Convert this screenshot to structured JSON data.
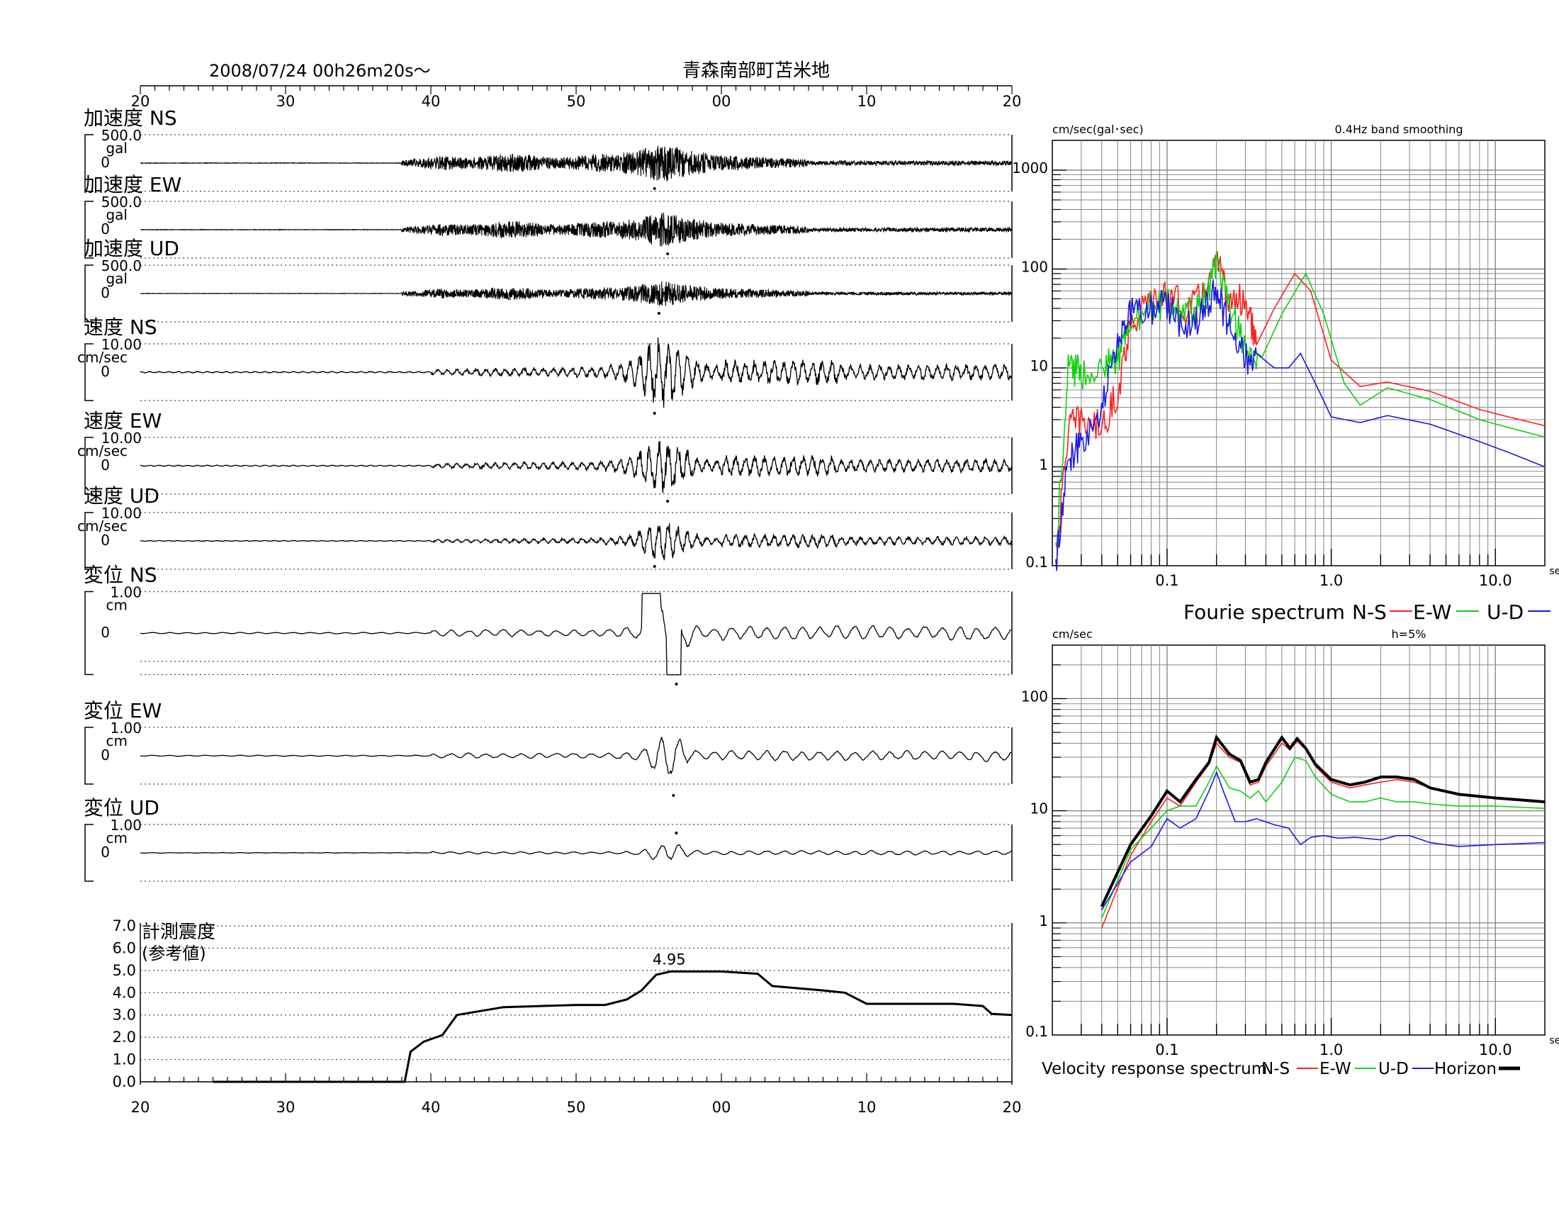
{
  "header": {
    "datetime": "2008/07/24  00h26m20s～",
    "station": "青森南部町苫米地"
  },
  "colors": {
    "ns": "#ff2020",
    "ew": "#10d010",
    "ud": "#1a1ae6",
    "horizon": "#000000",
    "wave": "#000000"
  },
  "time_axis": {
    "ticks": [
      "20",
      "30",
      "40",
      "50",
      "00",
      "10",
      "20"
    ]
  },
  "waveform_panels": [
    {
      "title": "加速度 NS",
      "scale_value": "500.0",
      "unit": "gal",
      "zero": "0"
    },
    {
      "title": "加速度 EW",
      "scale_value": "500.0",
      "unit": "gal",
      "zero": "0"
    },
    {
      "title": "加速度 UD",
      "scale_value": "500.0",
      "unit": "gal",
      "zero": "0"
    },
    {
      "title": "速度 NS",
      "scale_value": "10.00",
      "unit": "cm/sec",
      "zero": "0"
    },
    {
      "title": "速度 EW",
      "scale_value": "10.00",
      "unit": "cm/sec",
      "zero": "0"
    },
    {
      "title": "速度 UD",
      "scale_value": "10.00",
      "unit": "cm/sec",
      "zero": "0"
    },
    {
      "title": "変位 NS",
      "scale_value": "1.00",
      "unit": "cm",
      "zero": "0"
    },
    {
      "title": "変位 EW",
      "scale_value": "1.00",
      "unit": "cm",
      "zero": "0"
    },
    {
      "title": "変位 UD",
      "scale_value": "1.00",
      "unit": "cm",
      "zero": "0"
    }
  ],
  "chart_data": [
    {
      "type": "line",
      "title": "計測震度",
      "subtitle": "(参考値)",
      "ylim": [
        0,
        7
      ],
      "y_ticks": [
        "7.0",
        "6.0",
        "5.0",
        "4.0",
        "3.0",
        "2.0",
        "1.0",
        "0.0"
      ],
      "x_ticks": [
        "20",
        "30",
        "40",
        "50",
        "00",
        "10",
        "20"
      ],
      "peak_label": "4.95",
      "x": [
        25,
        38.2,
        38.6,
        39.5,
        40.8,
        41.8,
        45,
        50,
        52,
        53.5,
        54.5,
        55.5,
        56.5,
        60,
        62.5,
        63.5,
        67,
        68.5,
        70,
        76,
        78,
        78.6,
        80
      ],
      "values": [
        0,
        0,
        1.35,
        1.8,
        2.1,
        3.0,
        3.35,
        3.45,
        3.45,
        3.7,
        4.1,
        4.8,
        4.95,
        4.95,
        4.85,
        4.3,
        4.1,
        4.0,
        3.5,
        3.5,
        3.4,
        3.05,
        3.0
      ]
    },
    {
      "type": "line",
      "title": "Fourie spectrum",
      "y_unit_label": "cm/sec(gal･sec)",
      "note": "0.4Hz band smoothing",
      "x_unit": "sec",
      "x_scale": "log",
      "y_scale": "log",
      "xlim": [
        0.02,
        20
      ],
      "ylim": [
        0.1,
        2000
      ],
      "x_ticks": [
        "0.1",
        "1.0",
        "10.0"
      ],
      "y_ticks": [
        "1000",
        "100",
        "10",
        "1",
        "0.1"
      ],
      "legend": [
        "N-S",
        "E-W",
        "U-D"
      ],
      "series": [
        {
          "name": "N-S",
          "x": [
            0.021,
            0.025,
            0.03,
            0.04,
            0.05,
            0.06,
            0.08,
            0.1,
            0.13,
            0.16,
            0.2,
            0.24,
            0.3,
            0.35,
            0.45,
            0.6,
            0.75,
            1.0,
            1.5,
            2.2,
            4,
            8,
            12,
            20
          ],
          "values": [
            0.1,
            2.5,
            3,
            2.5,
            5.5,
            30,
            45,
            55,
            40,
            50,
            120,
            45,
            50,
            17,
            40,
            90,
            60,
            12,
            6.5,
            7.2,
            5.8,
            3.8,
            3.2,
            2.6
          ]
        },
        {
          "name": "E-W",
          "x": [
            0.021,
            0.025,
            0.03,
            0.04,
            0.05,
            0.06,
            0.08,
            0.1,
            0.13,
            0.16,
            0.2,
            0.24,
            0.3,
            0.38,
            0.5,
            0.7,
            0.9,
            1.2,
            1.5,
            2.2,
            4,
            8,
            12,
            20
          ],
          "values": [
            0.15,
            10,
            9,
            10,
            12,
            30,
            40,
            45,
            35,
            40,
            110,
            40,
            17,
            13,
            35,
            90,
            35,
            7,
            4.2,
            6.3,
            4.8,
            3.0,
            2.5,
            2.0
          ]
        },
        {
          "name": "U-D",
          "x": [
            0.021,
            0.025,
            0.03,
            0.04,
            0.05,
            0.06,
            0.08,
            0.1,
            0.13,
            0.16,
            0.2,
            0.24,
            0.3,
            0.35,
            0.45,
            0.55,
            0.65,
            0.8,
            1.0,
            1.5,
            2.2,
            4,
            8,
            12,
            20
          ],
          "values": [
            0.1,
            1.2,
            1.8,
            4,
            18,
            35,
            40,
            45,
            25,
            35,
            60,
            25,
            12,
            14,
            10,
            10,
            14,
            7,
            3.2,
            2.8,
            3.3,
            2.7,
            1.8,
            1.4,
            1.0
          ]
        }
      ]
    },
    {
      "type": "line",
      "title": "Velocity response spectrum",
      "y_unit_label": "cm/sec",
      "note": "h=5%",
      "x_unit": "sec",
      "x_scale": "log",
      "y_scale": "log",
      "xlim": [
        0.02,
        20
      ],
      "ylim": [
        0.1,
        300
      ],
      "x_ticks": [
        "0.1",
        "1.0",
        "10.0"
      ],
      "y_ticks": [
        "100",
        "10",
        "1",
        "0.1"
      ],
      "legend": [
        "N-S",
        "E-W",
        "U-D",
        "Horizon"
      ],
      "series": [
        {
          "name": "N-S",
          "x": [
            0.04,
            0.06,
            0.08,
            0.1,
            0.12,
            0.15,
            0.18,
            0.2,
            0.24,
            0.28,
            0.32,
            0.36,
            0.4,
            0.5,
            0.56,
            0.62,
            0.7,
            0.8,
            1.0,
            1.3,
            1.6,
            2.0,
            2.5,
            3.2,
            4,
            6,
            10,
            20
          ],
          "values": [
            0.9,
            4,
            8,
            13,
            11,
            18,
            26,
            40,
            30,
            27,
            17,
            18,
            25,
            40,
            35,
            42,
            35,
            25,
            18,
            16,
            17,
            18,
            19,
            18,
            16,
            14,
            13,
            12
          ]
        },
        {
          "name": "E-W",
          "x": [
            0.04,
            0.06,
            0.08,
            0.1,
            0.12,
            0.15,
            0.18,
            0.2,
            0.24,
            0.28,
            0.32,
            0.36,
            0.4,
            0.5,
            0.6,
            0.7,
            0.8,
            1.0,
            1.3,
            1.6,
            2.0,
            2.5,
            3.2,
            4,
            6,
            10,
            20
          ],
          "values": [
            1.1,
            4.5,
            7,
            10,
            11,
            11,
            18,
            25,
            16,
            15,
            13,
            15,
            12,
            18,
            30,
            28,
            20,
            14,
            12,
            12,
            13,
            12,
            12,
            11.5,
            11,
            11,
            10.5
          ]
        },
        {
          "name": "U-D",
          "x": [
            0.04,
            0.06,
            0.08,
            0.1,
            0.12,
            0.15,
            0.18,
            0.2,
            0.22,
            0.26,
            0.3,
            0.35,
            0.45,
            0.55,
            0.65,
            0.75,
            0.9,
            1.1,
            1.4,
            2.0,
            2.5,
            3.0,
            4,
            6,
            10,
            20
          ],
          "values": [
            1.3,
            3.5,
            4.8,
            8.5,
            7,
            8.5,
            15,
            22,
            15,
            8,
            8,
            8.5,
            7.5,
            7,
            5,
            5.8,
            6,
            5.7,
            5.8,
            5.5,
            6,
            6,
            5.2,
            4.8,
            5,
            5.2
          ]
        },
        {
          "name": "Horizon",
          "x": [
            0.04,
            0.06,
            0.08,
            0.1,
            0.12,
            0.15,
            0.18,
            0.2,
            0.24,
            0.28,
            0.32,
            0.36,
            0.4,
            0.5,
            0.56,
            0.62,
            0.7,
            0.8,
            1.0,
            1.3,
            1.6,
            2.0,
            2.5,
            3.2,
            4,
            6,
            10,
            20
          ],
          "values": [
            1.4,
            5,
            9,
            15,
            12,
            19,
            27,
            45,
            32,
            28,
            18,
            19,
            27,
            45,
            36,
            44,
            36,
            26,
            19,
            17,
            18,
            20,
            20,
            19,
            16,
            14,
            13,
            12
          ]
        }
      ]
    }
  ]
}
